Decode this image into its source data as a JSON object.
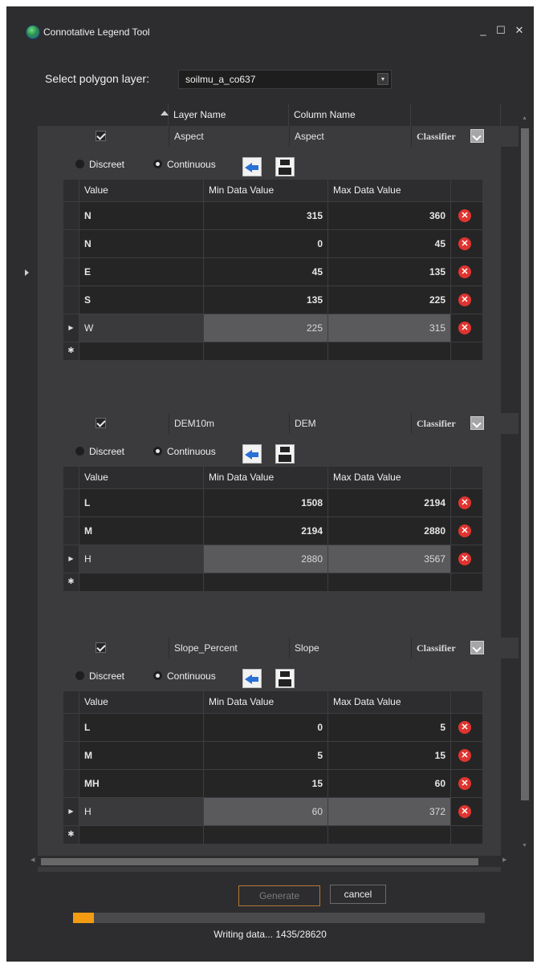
{
  "window": {
    "title": "Connotative Legend Tool",
    "minimize_label": "_",
    "maximize_label": "☐",
    "close_label": "✕"
  },
  "layer_select": {
    "label": "Select polygon layer:",
    "value": "soilmu_a_co637",
    "arrow": "▾"
  },
  "grid": {
    "columns": [
      "Layer Name",
      "Column Name"
    ],
    "icons": {
      "sort": "sort-ascending-icon"
    },
    "classifier_label": "Classifier",
    "radio_discreet": "Discreet",
    "radio_continuous": "Continuous",
    "inner_columns": [
      "Value",
      "Min Data Value",
      "Max Data Value"
    ],
    "layers": [
      {
        "checked": true,
        "layer_name": "Aspect",
        "column_name": "Aspect",
        "mode": "Continuous",
        "rows": [
          {
            "value": "N",
            "min": "315",
            "max": "360"
          },
          {
            "value": "N",
            "min": "0",
            "max": "45"
          },
          {
            "value": "E",
            "min": "45",
            "max": "135"
          },
          {
            "value": "S",
            "min": "135",
            "max": "225"
          },
          {
            "value": "W",
            "min": "225",
            "max": "315",
            "current": true
          }
        ]
      },
      {
        "checked": true,
        "layer_name": "DEM10m",
        "column_name": "DEM",
        "mode": "Continuous",
        "rows": [
          {
            "value": "L",
            "min": "1508",
            "max": "2194"
          },
          {
            "value": "M",
            "min": "2194",
            "max": "2880"
          },
          {
            "value": "H",
            "min": "2880",
            "max": "3567",
            "current": true
          }
        ]
      },
      {
        "checked": true,
        "layer_name": "Slope_Percent",
        "column_name": "Slope",
        "mode": "Continuous",
        "rows": [
          {
            "value": "L",
            "min": "0",
            "max": "5"
          },
          {
            "value": "M",
            "min": "5",
            "max": "15"
          },
          {
            "value": "MH",
            "min": "15",
            "max": "60"
          },
          {
            "value": "H",
            "min": "60",
            "max": "372",
            "current": true
          }
        ]
      }
    ]
  },
  "buttons": {
    "generate": "Generate",
    "cancel": "cancel"
  },
  "progress": {
    "fraction": 0.05,
    "status": "Writing data... 1435/28620"
  },
  "colors": {
    "background": "#2d2d30",
    "accent": "#f39c12",
    "delete": "#e0342f"
  }
}
